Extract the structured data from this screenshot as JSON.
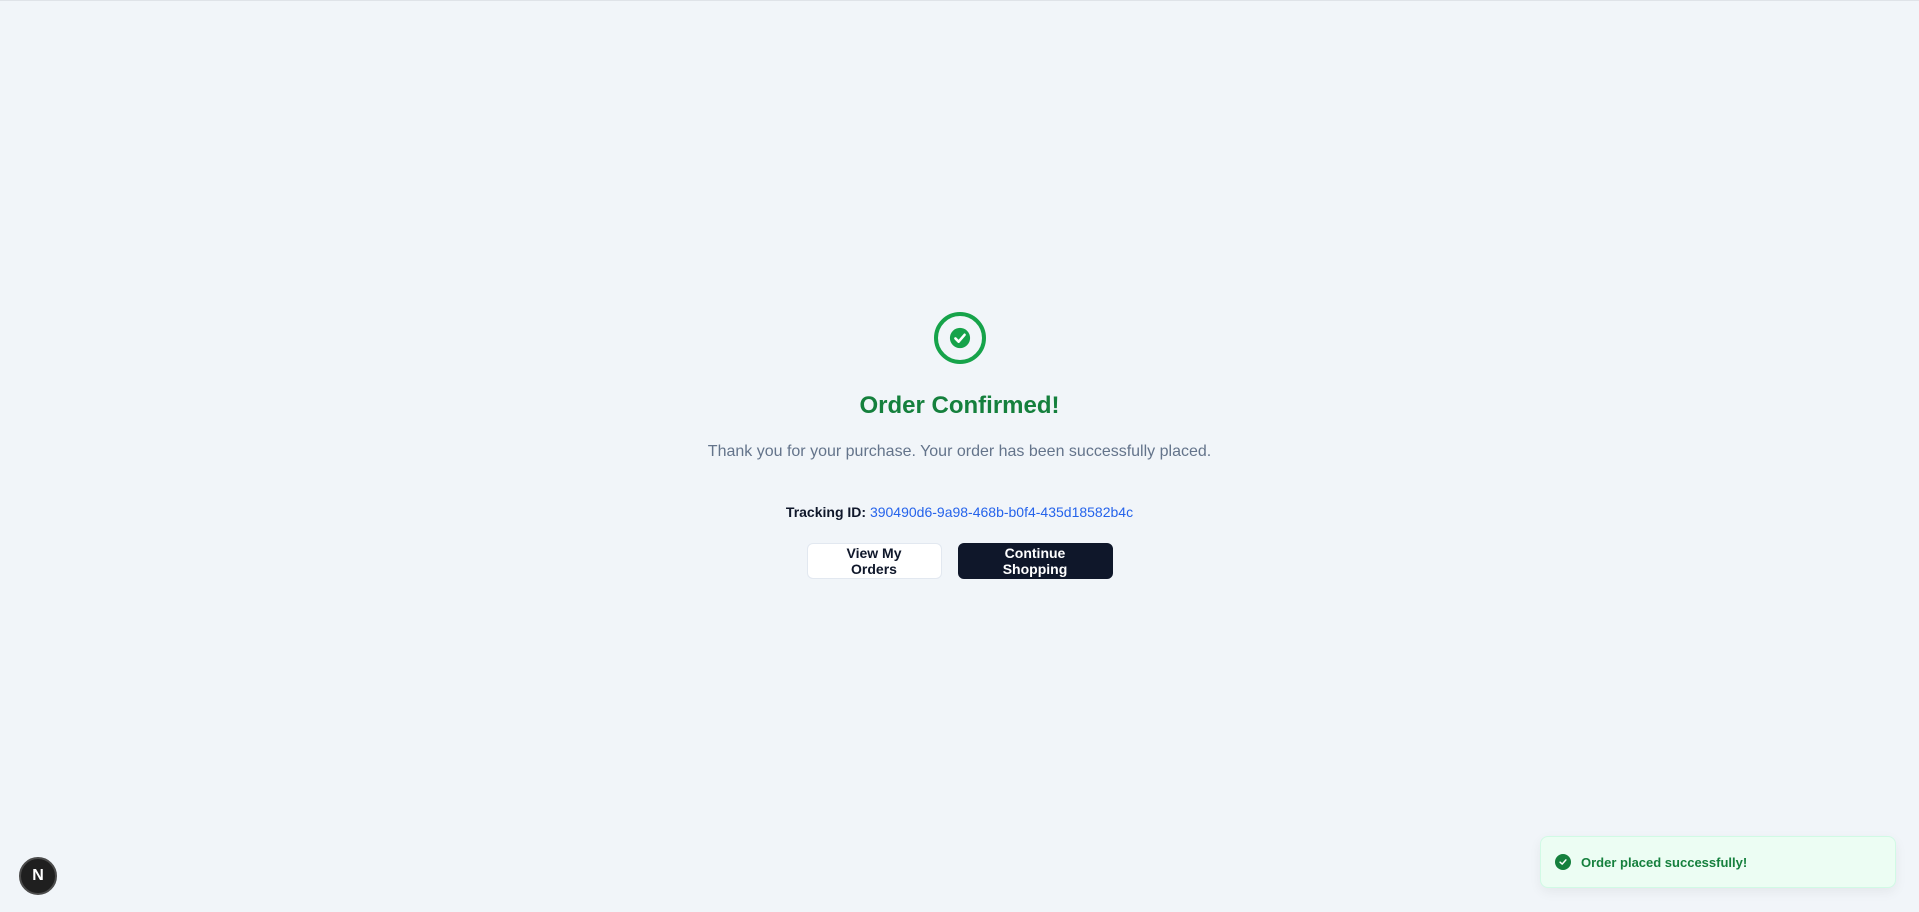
{
  "confirmation": {
    "title": "Order Confirmed!",
    "message": "Thank you for your purchase. Your order has been successfully placed.",
    "tracking_label": "Tracking ID:",
    "tracking_id": "390490d6-9a98-468b-b0f4-435d18582b4c",
    "icon": "check-circle-icon"
  },
  "actions": {
    "view_orders_label": "View My Orders",
    "continue_label": "Continue Shopping"
  },
  "toast": {
    "message": "Order placed successfully!",
    "icon": "check-circle-icon"
  },
  "dev_badge": {
    "letter": "N"
  },
  "colors": {
    "success": "#16a34a",
    "title": "#15803d",
    "link": "#2563eb",
    "primary": "#0f172a",
    "background": "#f1f5f9"
  }
}
